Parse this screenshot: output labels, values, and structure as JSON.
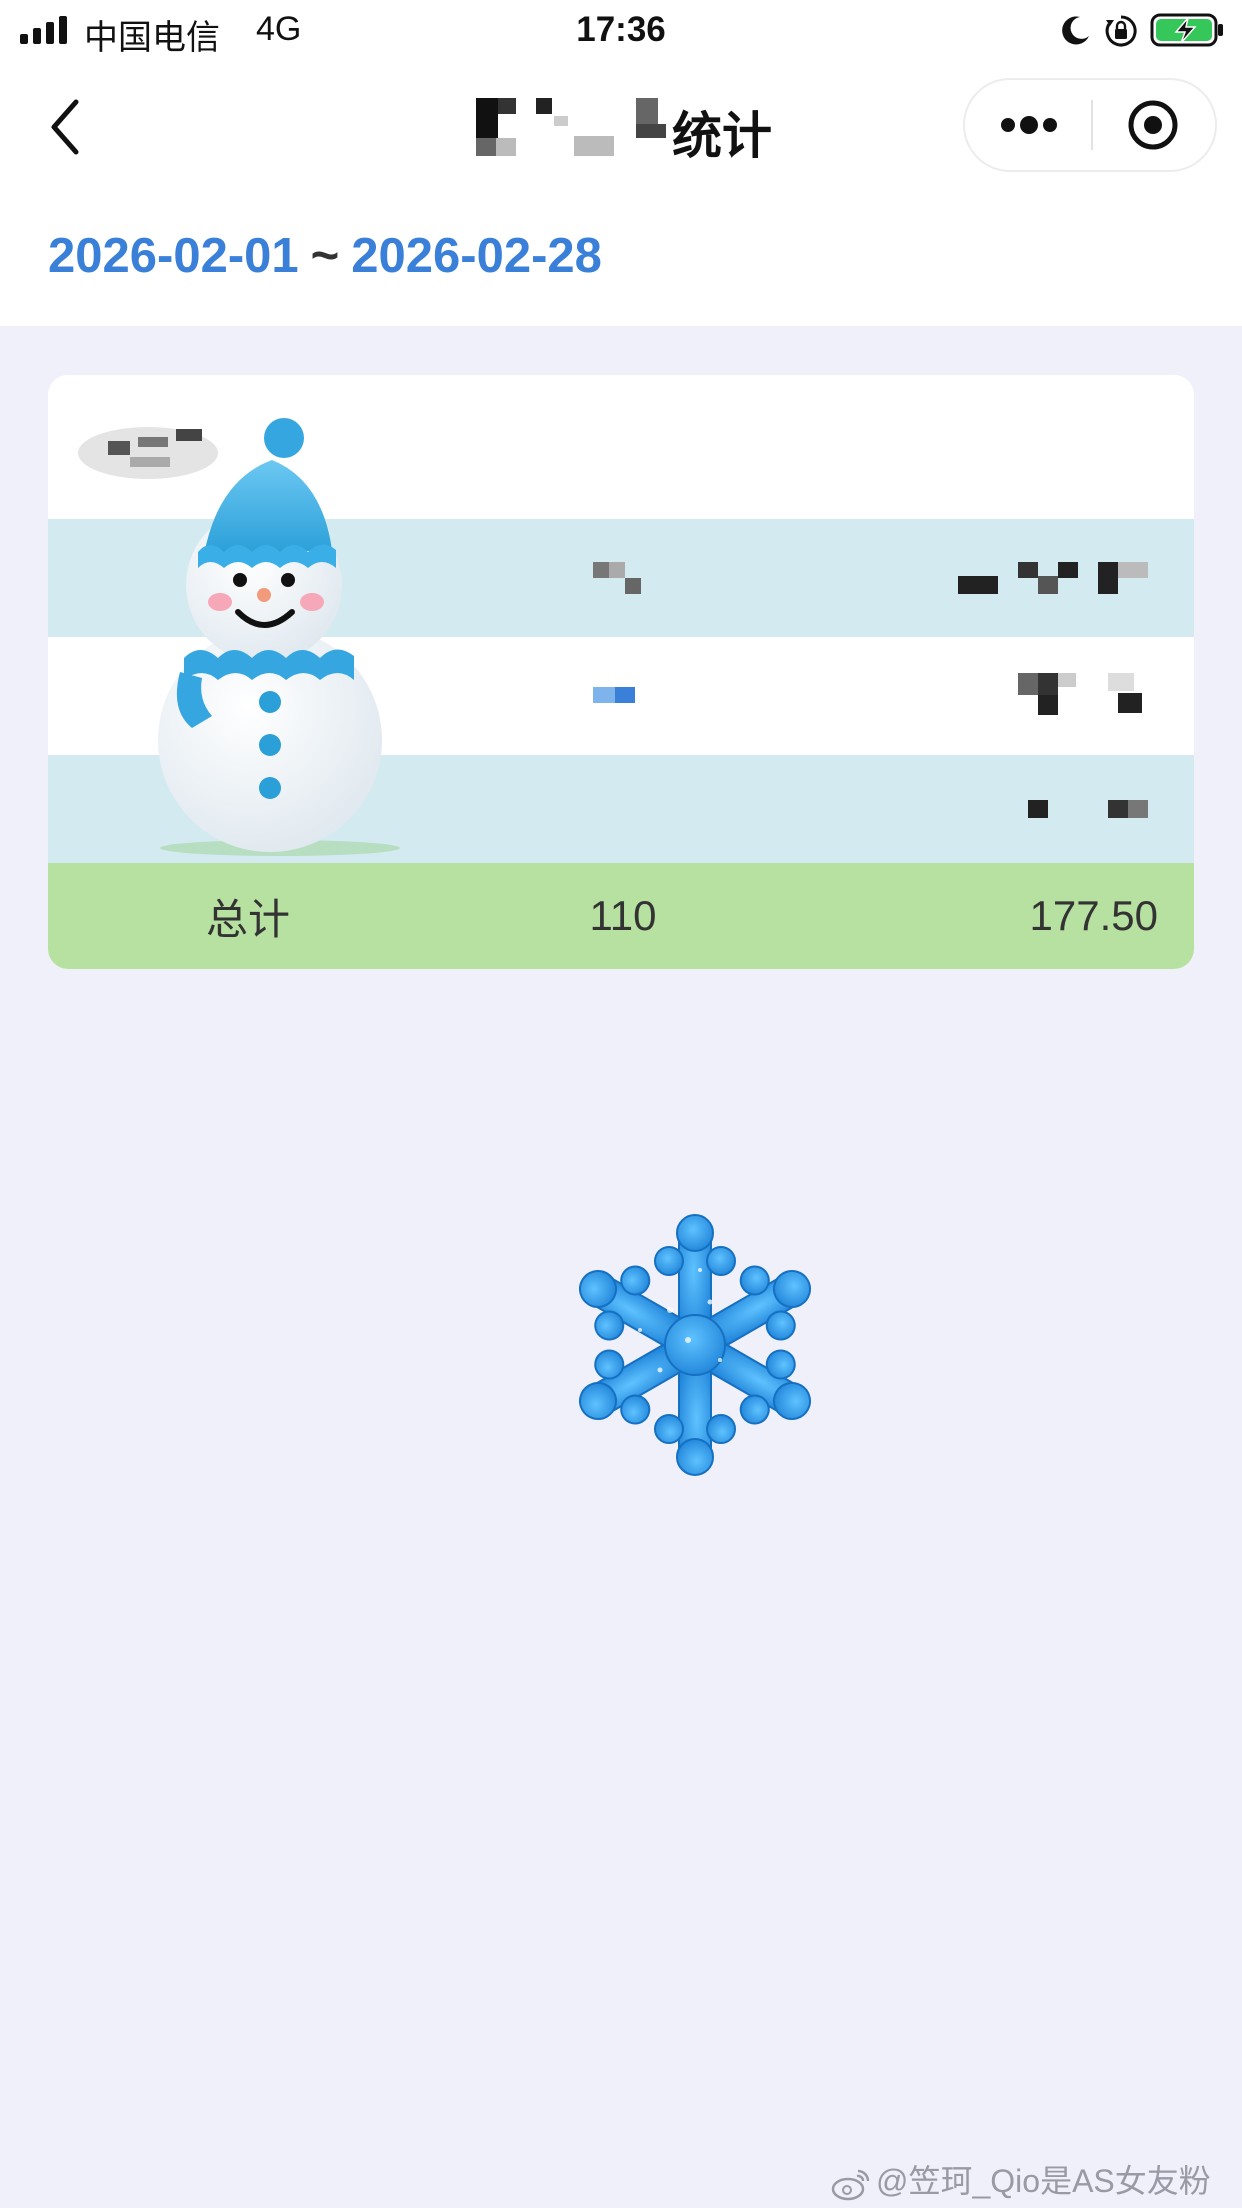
{
  "status_bar": {
    "carrier": "中国电信",
    "network": "4G",
    "time": "17:36",
    "icons": [
      "signal-icon",
      "moon-icon",
      "rotation-lock-icon",
      "battery-charging-icon"
    ]
  },
  "nav": {
    "title_suffix": "统计",
    "back_icon": "chevron-left-icon",
    "more_icon": "more-dots-icon",
    "close_icon": "target-close-icon"
  },
  "date_range": {
    "start": "2026-02-01",
    "separator": "~",
    "end": "2026-02-28"
  },
  "table": {
    "total_row": {
      "label": "总计",
      "count": "110",
      "amount": "177.50"
    }
  },
  "colors": {
    "accent_blue": "#3a80d8",
    "row_blue": "#d3eaf0",
    "total_green": "#b7e1a1",
    "page_bg": "#f0f0fa"
  },
  "watermark": {
    "text": "@笠珂_Qio是AS女友粉"
  }
}
